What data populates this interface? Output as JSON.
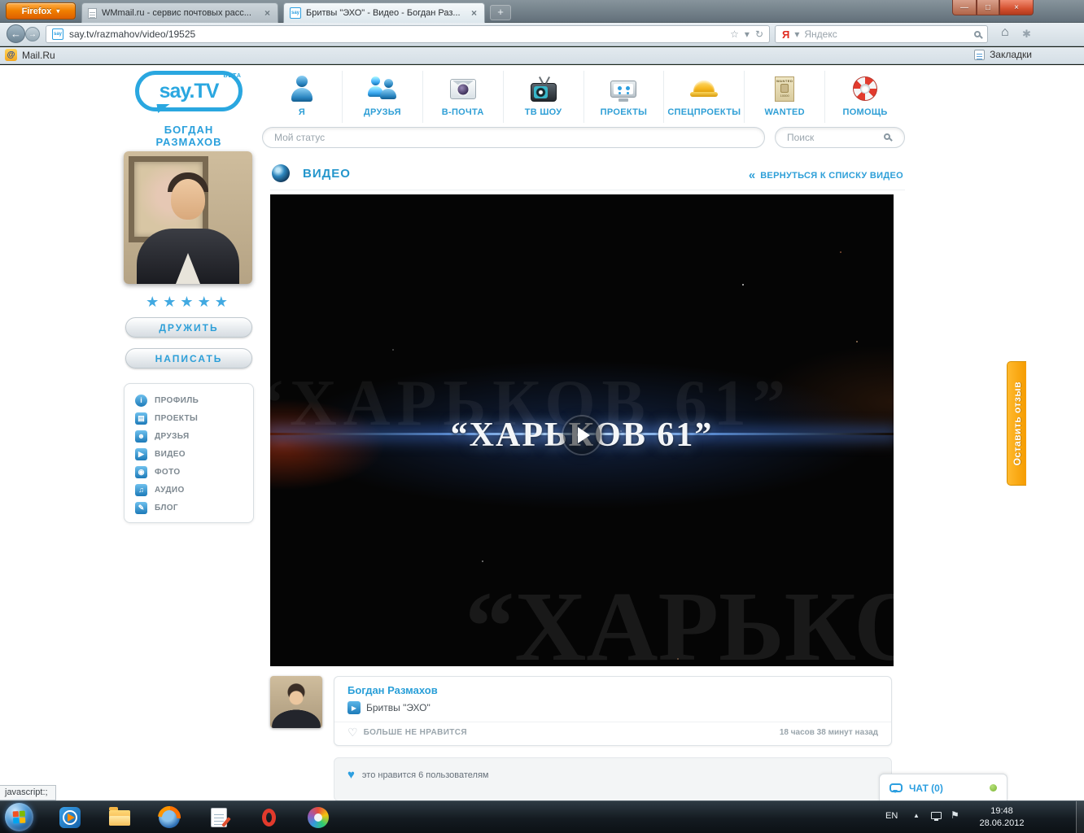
{
  "browser": {
    "firefox_button": "Firefox",
    "tabs": [
      {
        "title": "WMmail.ru - сервис почтовых расс..."
      },
      {
        "title": "Бритвы \"ЭХО\" - Видео - Богдан Раз..."
      }
    ],
    "url": "say.tv/razmahov/video/19525",
    "favicon_text": "say",
    "yandex": {
      "logo": "Я",
      "placeholder": "Яндекс"
    },
    "bookmarks": {
      "mailru": "Mail.Ru",
      "bookmarks_label": "Закладки"
    },
    "status_popup": "javascript:;",
    "icons": {
      "caret": "▾",
      "close": "×",
      "plus": "+",
      "back": "←",
      "forward": "→",
      "star": "☆",
      "refresh": "↻",
      "home": "⌂",
      "flower": "✱",
      "minimize": "—",
      "maximize": "□",
      "mail_at": "@",
      "chevrons": "«",
      "heart": "♥",
      "heart_outline": "♡",
      "play": "▶",
      "tray_up": "▲",
      "flag": "⚑"
    }
  },
  "page": {
    "logo": {
      "text": "say.TV",
      "beta": "BETA"
    },
    "profile": {
      "first_name": "БОГДАН",
      "last_name": "РАЗМАХОВ",
      "stars": "★★★★★",
      "friend_button": "ДРУЖИТЬ",
      "write_button": "НАПИСАТЬ",
      "menu": [
        {
          "label": "ПРОФИЛЬ",
          "glyph": "i"
        },
        {
          "label": "ПРОЕКТЫ",
          "glyph": "▤"
        },
        {
          "label": "ДРУЗЬЯ",
          "glyph": "☻"
        },
        {
          "label": "ВИДЕО",
          "glyph": "▶"
        },
        {
          "label": "ФОТО",
          "glyph": "◉"
        },
        {
          "label": "АУДИО",
          "glyph": "♫"
        },
        {
          "label": "БЛОГ",
          "glyph": "✎"
        }
      ]
    },
    "topnav": [
      {
        "label": "Я"
      },
      {
        "label": "ДРУЗЬЯ"
      },
      {
        "label": "В-ПОЧТА"
      },
      {
        "label": "ТВ ШОУ"
      },
      {
        "label": "ПРОЕКТЫ"
      },
      {
        "label": "СПЕЦПРОЕКТЫ"
      },
      {
        "label": "WANTED",
        "poster_line1": "WANTED",
        "poster_line2": "10000"
      },
      {
        "label": "ПОМОЩЬ"
      }
    ],
    "status_placeholder": "Мой статус",
    "search_placeholder": "Поиск",
    "video": {
      "section_title": "ВИДЕО",
      "back_link": "ВЕРНУТЬСЯ К СПИСКУ ВИДЕО",
      "overlay_title": "“ХАРЬКОВ 61”",
      "ghost_left": "“ХАРЬКОВ 61”",
      "ghost_bottom": "“ХАРЬКО",
      "author": "Богдан Размахов",
      "clip_title": "Бритвы \"ЭХО\"",
      "unlike_label": "БОЛЬШЕ НЕ НРАВИТСЯ",
      "posted_ago": "18 часов 38 минут назад",
      "likes_text": "это нравится 6 пользователям"
    },
    "chat_label": "ЧАТ (0)",
    "feedback_label": "Оставить отзыв"
  },
  "taskbar": {
    "lang": "EN",
    "time": "19:48",
    "date": "28.06.2012"
  }
}
